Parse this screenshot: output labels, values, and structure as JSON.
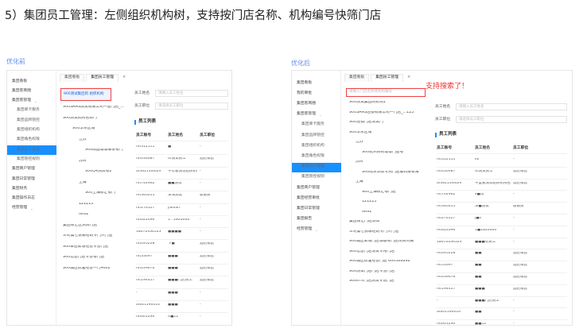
{
  "heading": "5）集团员工管理：左侧组织机构树，支持按门店名称、机构编号快筛门店",
  "before": {
    "caption": "优化前",
    "sidebar": [
      {
        "label": "集团看板",
        "type": "top"
      },
      {
        "label": "集团客商圈",
        "type": "top"
      },
      {
        "label": "集团客管理",
        "type": "top",
        "chevron": true
      },
      {
        "label": "集团库卡服务",
        "type": "sub"
      },
      {
        "label": "集团品牌管控",
        "type": "sub"
      },
      {
        "label": "集团组织机构",
        "type": "sub"
      },
      {
        "label": "集团角色权限",
        "type": "sub"
      },
      {
        "label": "集团员工管理",
        "type": "sub",
        "active": true
      },
      {
        "label": "集团管控规则",
        "type": "sub"
      },
      {
        "label": "集团商户管理",
        "type": "top"
      },
      {
        "label": "集团日常管理",
        "type": "top"
      },
      {
        "label": "集团财务",
        "type": "top"
      },
      {
        "label": "集团操作日志",
        "type": "top"
      },
      {
        "label": "经营管理",
        "type": "top",
        "chevron": true
      }
    ],
    "tabs": [
      "集团看板",
      "集团员工管理"
    ],
    "tab_close": "×",
    "fields": [
      {
        "label": "员工姓名",
        "placeholder": "请输入员工姓名"
      },
      {
        "label": "员工职位",
        "placeholder": "请选择员工职位"
      }
    ],
    "tree_search_value": "900测试集团的 组织机构",
    "tree": [
      "900SAAS测试有限公司一店门店_...",
      "900测试机构名称门",
      "900华东区域",
      "江苏",
      "900南昌等等哪份号门",
      "苏州",
      "900Q4测试号2",
      "上海",
      "900上海徐汇号门",
      "121213",
      "tets2",
      "集团徐汇区测试门店",
      "三利第七张哪经的专门只门店",
      "900莘庄新增经营专营门店",
      "900信息门店专营号门店",
      "900城区标准经营一门4602"
    ],
    "table_title": "员工列表",
    "columns": [
      "员工账号",
      "员工姓名",
      "员工职位"
    ],
    "rows": [
      [
        "mt312111",
        "■",
        "-"
      ],
      [
        "mt430087",
        "UI测试员工",
        "酒店销售"
      ],
      [
        "af36213I4629",
        "千年看测试组织机构门",
        "-"
      ],
      [
        "mt744962",
        "■■测试",
        "-"
      ],
      [
        "mt340015",
        "洋洋测试",
        "收银员"
      ],
      [
        "mt276127",
        "Jianlan",
        "-"
      ],
      [
        "mt622096",
        "1...1820006",
        "-"
      ],
      [
        "18672036523",
        "■■■■",
        "-"
      ],
      [
        "mt495228",
        "下■",
        "酒店销售"
      ],
      [
        "mt33697",
        "■■■",
        "酒店销售"
      ],
      [
        "mt439676",
        "■■■",
        "酒店销售"
      ],
      [
        "mt194457",
        "■■■门店员工",
        "酒店销售"
      ],
      [
        "-",
        "■■■",
        "-"
      ],
      [
        "af601190010",
        "■■■",
        "-"
      ],
      [
        "mt601290",
        "X■12",
        "-"
      ]
    ]
  },
  "after": {
    "caption": "优化后",
    "annotation": "支持搜索了！",
    "sidebar": [
      {
        "label": "集团看板",
        "type": "top"
      },
      {
        "label": "我的审批",
        "type": "top"
      },
      {
        "label": "集团客商圈",
        "type": "top"
      },
      {
        "label": "集团客管理",
        "type": "top",
        "chevron": true
      },
      {
        "label": "集团库卡服务",
        "type": "sub"
      },
      {
        "label": "集团品牌管控",
        "type": "sub"
      },
      {
        "label": "集团组织机构",
        "type": "sub"
      },
      {
        "label": "集团角色权限",
        "type": "sub"
      },
      {
        "label": "集团员工管理",
        "type": "sub",
        "active": true
      },
      {
        "label": "集团管控规则",
        "type": "sub"
      },
      {
        "label": "集团商户管理",
        "type": "top"
      },
      {
        "label": "集团经营审批",
        "type": "top"
      },
      {
        "label": "集团日常管理",
        "type": "top"
      },
      {
        "label": "集团报告",
        "type": "top"
      },
      {
        "label": "经营管理",
        "type": "top",
        "chevron": true
      }
    ],
    "tabs": [
      "集团看板",
      "集团员工管理"
    ],
    "tab_close": "×",
    "search_placeholder": "请输入门店名称或机构编号",
    "fields": [
      {
        "label": "员工姓名",
        "placeholder": "请输入员工姓名"
      },
      {
        "label": "员工职位",
        "placeholder": "请选择员工职位"
      }
    ],
    "tree": [
      "900测试集团的机构1",
      "900SAAS连锁有限公司一门店_...123",
      "900连锁门店测试门",
      "900华东区域",
      "江苏",
      "900杭州好的等等门店号",
      "苏州",
      "900南京测试专用门店美科技有限",
      "上海",
      "900上海徐汇号门店",
      "121213",
      "tets2",
      "集团徐汇门店测试",
      "三利第七张哪经的专门只门店",
      "900城区新增门店等级号门店项目列表",
      "900信息门店测试专用门店",
      "900城区标准经营门店 600388898",
      "900测试门店门店专营门店",
      "9000TX门店测试专营门店"
    ],
    "table_title": "员工列表",
    "columns": [
      "员工账号",
      "员工姓名",
      "员工职位"
    ],
    "rows": [
      [
        "mt312111",
        "ldl",
        "-"
      ],
      [
        "mt430087",
        "UI测试员工",
        "酒店销售"
      ],
      [
        "af36213I4629",
        "千里看测试组织机构名",
        "酒店销售"
      ],
      [
        "mt744962",
        "x■试",
        "-"
      ],
      [
        "mt340015",
        "洋■测试",
        "收银员"
      ],
      [
        "mt276127",
        "J■n",
        "-"
      ],
      [
        "mt622096",
        "1■1820006",
        "-"
      ],
      [
        "18672036523",
        "■■■有员工",
        "-"
      ],
      [
        "mt495228",
        "■■",
        "酒店销售"
      ],
      [
        "mt55697",
        "■■",
        "酒店销售"
      ],
      [
        "mt439676",
        "■■",
        "酒店销售"
      ],
      [
        "mt194457",
        "■■■",
        "酒店销售"
      ],
      [
        "-",
        "■■■门店员工",
        "-"
      ],
      [
        "af601190010",
        "■■",
        "-"
      ],
      [
        "mt601290",
        "■■12",
        "-"
      ]
    ]
  }
}
